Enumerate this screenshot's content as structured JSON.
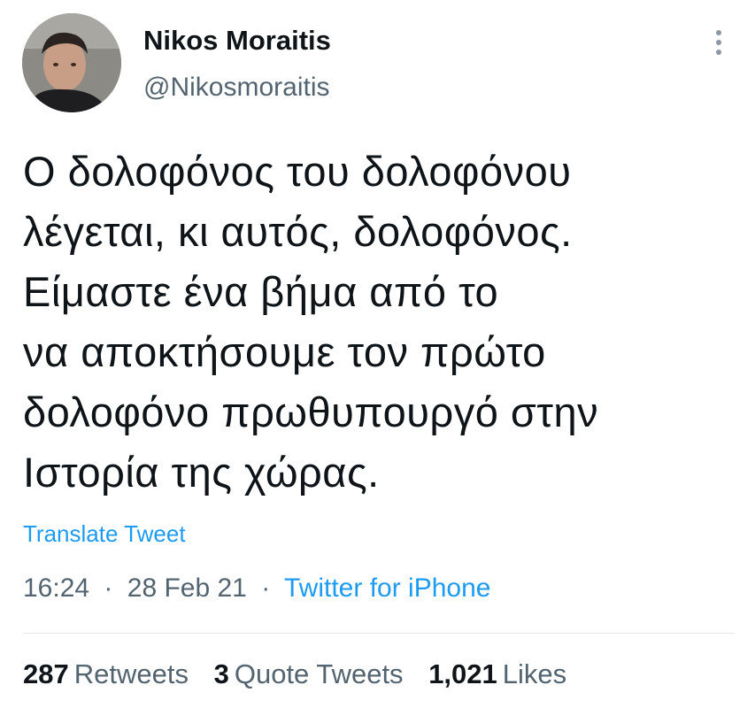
{
  "author": {
    "name": "Nikos Moraitis",
    "handle": "@Nikosmoraitis"
  },
  "tweet": {
    "lines": [
      "Ο δολοφόνος του δολοφόνου",
      "λέγεται, κι αυτός, δολοφόνος.",
      "Είμαστε ένα βήμα από το",
      "να αποκτήσουμε τον πρώτο",
      "δολοφόνο πρωθυπουργό στην",
      "Ιστορία της χώρας."
    ],
    "translate_label": "Translate Tweet"
  },
  "meta": {
    "time": "16:24",
    "separator": "·",
    "date": "28 Feb 21",
    "source": "Twitter for iPhone"
  },
  "stats": {
    "retweets_count": "287",
    "retweets_label": "Retweets",
    "quotes_count": "3",
    "quotes_label": "Quote Tweets",
    "likes_count": "1,021",
    "likes_label": "Likes"
  },
  "icons": {
    "more": "more-vertical-icon"
  },
  "colors": {
    "link": "#1d9bf0",
    "secondary_text": "#536471",
    "primary_text": "#0f1419"
  }
}
